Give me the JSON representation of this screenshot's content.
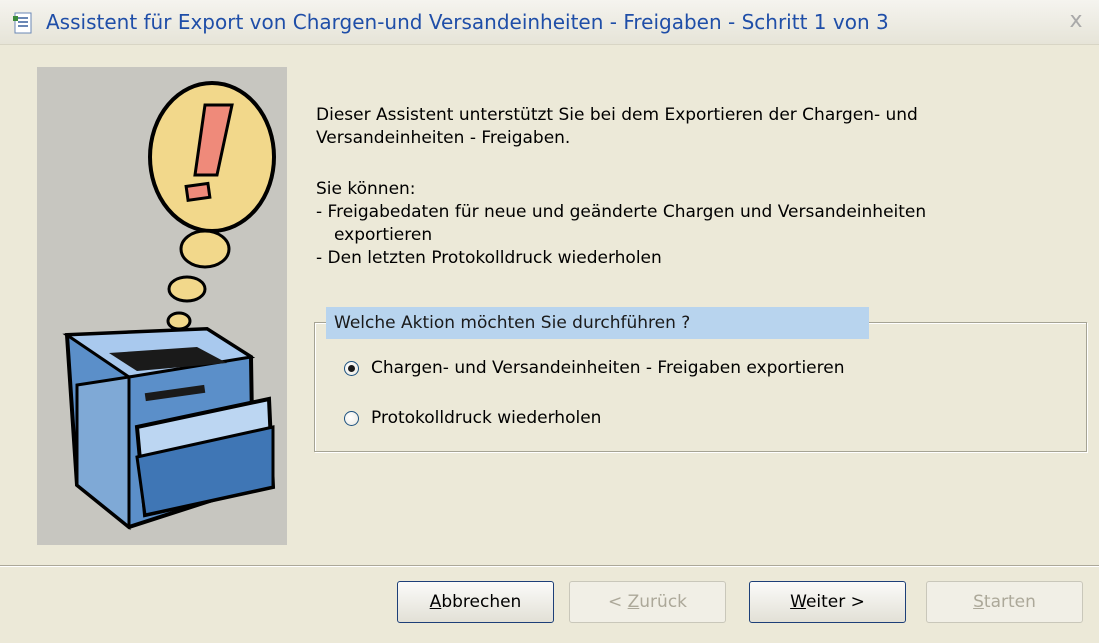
{
  "window": {
    "title": "Assistent für Export von Chargen-und Versandeinheiten - Freigaben - Schritt 1 von 3",
    "close_glyph": "x"
  },
  "intro": {
    "line1": "Dieser Assistent unterstützt Sie bei dem Exportieren der Chargen- und",
    "line2": "Versandeinheiten - Freigaben."
  },
  "options_text": {
    "heading": "Sie können:",
    "item1_line1": "-  Freigabedaten für neue und geänderte Chargen und Versandeinheiten",
    "item1_line2": "exportieren",
    "item2": "-  Den letzten Protokolldruck wiederholen"
  },
  "group": {
    "legend": "Welche Aktion möchten Sie durchführen ?",
    "options": [
      {
        "label": "Chargen- und Versandeinheiten - Freigaben exportieren",
        "checked": true
      },
      {
        "label": "Protokolldruck wiederholen",
        "checked": false
      }
    ]
  },
  "buttons": {
    "cancel": {
      "mnemonic": "A",
      "rest": "bbrechen"
    },
    "back": {
      "prefix": "< ",
      "mnemonic": "Z",
      "rest": "urück",
      "enabled": false
    },
    "next": {
      "mnemonic": "W",
      "rest": "eiter >"
    },
    "start": {
      "mnemonic": "S",
      "rest": "tarten",
      "enabled": false
    }
  },
  "icons": {
    "title": "wizard-window-icon",
    "illustration": "printer-warning-illustration"
  },
  "colors": {
    "title_text": "#1f4ea8",
    "legend_highlight": "#b8d4ee",
    "dialog_bg": "#ece9d8"
  }
}
